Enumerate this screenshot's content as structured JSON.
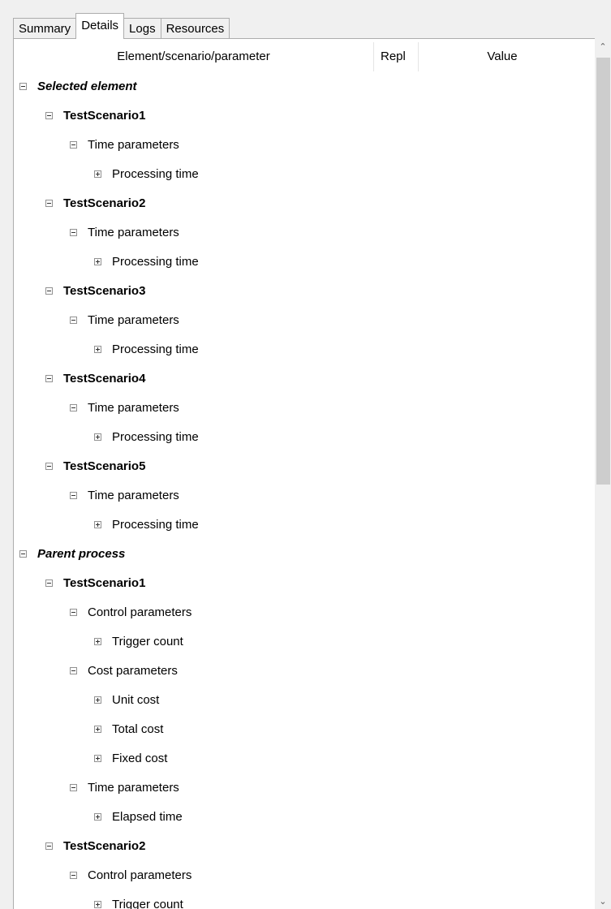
{
  "tabs": [
    {
      "label": "Summary",
      "active": false
    },
    {
      "label": "Details",
      "active": true
    },
    {
      "label": "Logs",
      "active": false
    },
    {
      "label": "Resources",
      "active": false
    }
  ],
  "columns": {
    "element": "Element/scenario/parameter",
    "repl": "Repl",
    "value": "Value"
  },
  "tree": [
    {
      "label": "Selected element",
      "level": 0,
      "state": "expanded"
    },
    {
      "label": "TestScenario1",
      "level": 1,
      "state": "expanded"
    },
    {
      "label": "Time parameters",
      "level": 2,
      "state": "expanded"
    },
    {
      "label": "Processing time",
      "level": 3,
      "state": "collapsed"
    },
    {
      "label": "TestScenario2",
      "level": 1,
      "state": "expanded"
    },
    {
      "label": "Time parameters",
      "level": 2,
      "state": "expanded"
    },
    {
      "label": "Processing time",
      "level": 3,
      "state": "collapsed"
    },
    {
      "label": "TestScenario3",
      "level": 1,
      "state": "expanded"
    },
    {
      "label": "Time parameters",
      "level": 2,
      "state": "expanded"
    },
    {
      "label": "Processing time",
      "level": 3,
      "state": "collapsed"
    },
    {
      "label": "TestScenario4",
      "level": 1,
      "state": "expanded"
    },
    {
      "label": "Time parameters",
      "level": 2,
      "state": "expanded"
    },
    {
      "label": "Processing time",
      "level": 3,
      "state": "collapsed"
    },
    {
      "label": "TestScenario5",
      "level": 1,
      "state": "expanded"
    },
    {
      "label": "Time parameters",
      "level": 2,
      "state": "expanded"
    },
    {
      "label": "Processing time",
      "level": 3,
      "state": "collapsed"
    },
    {
      "label": "Parent process",
      "level": 0,
      "state": "expanded"
    },
    {
      "label": "TestScenario1",
      "level": 1,
      "state": "expanded"
    },
    {
      "label": "Control parameters",
      "level": 2,
      "state": "expanded"
    },
    {
      "label": "Trigger count",
      "level": 3,
      "state": "collapsed"
    },
    {
      "label": "Cost parameters",
      "level": 2,
      "state": "expanded"
    },
    {
      "label": "Unit cost",
      "level": 3,
      "state": "collapsed"
    },
    {
      "label": "Total cost",
      "level": 3,
      "state": "collapsed"
    },
    {
      "label": "Fixed cost",
      "level": 3,
      "state": "collapsed"
    },
    {
      "label": "Time parameters",
      "level": 2,
      "state": "expanded"
    },
    {
      "label": "Elapsed time",
      "level": 3,
      "state": "collapsed"
    },
    {
      "label": "TestScenario2",
      "level": 1,
      "state": "expanded"
    },
    {
      "label": "Control parameters",
      "level": 2,
      "state": "expanded"
    },
    {
      "label": "Trigger count",
      "level": 3,
      "state": "collapsed"
    }
  ],
  "scrollbar": {
    "up_icon": "chevron-up-icon",
    "down_icon": "chevron-down-icon"
  }
}
